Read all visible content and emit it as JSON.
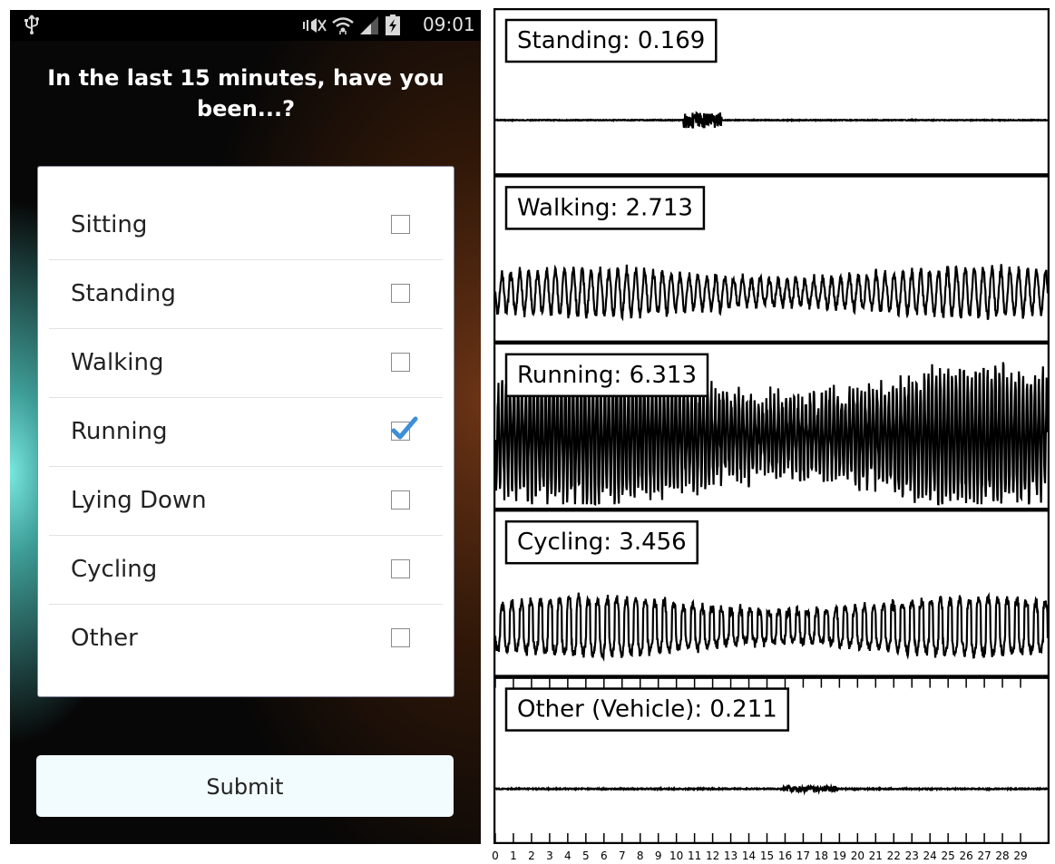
{
  "phone": {
    "status": {
      "time": "09:01",
      "icons": [
        "usb-icon",
        "silent-mode-icon",
        "wifi-icon",
        "signal-icon",
        "battery-charging-icon"
      ]
    },
    "question": "In the last 15 minutes, have you been...?",
    "options": [
      {
        "label": "Sitting",
        "checked": false
      },
      {
        "label": "Standing",
        "checked": false
      },
      {
        "label": "Walking",
        "checked": false
      },
      {
        "label": "Running",
        "checked": true
      },
      {
        "label": "Lying Down",
        "checked": false
      },
      {
        "label": "Cycling",
        "checked": false
      },
      {
        "label": "Other",
        "checked": false
      }
    ],
    "submit_label": "Submit",
    "accent_color": "#3d8fd6"
  },
  "chart_data": {
    "type": "line",
    "x_ticks": [
      "0",
      "1",
      "2",
      "3",
      "4",
      "5",
      "6",
      "7",
      "8",
      "9",
      "10",
      "11",
      "12",
      "13",
      "14",
      "15",
      "16",
      "17",
      "18",
      "19",
      "20",
      "21",
      "22",
      "23",
      "24",
      "25",
      "26",
      "27",
      "28",
      "29"
    ],
    "xlim": [
      0,
      30
    ],
    "grid": false,
    "panels": [
      {
        "label": "Standing: 0.169",
        "value": 0.169
      },
      {
        "label": "Walking: 2.713",
        "value": 2.713
      },
      {
        "label": "Running: 6.313",
        "value": 6.313
      },
      {
        "label": "Cycling: 3.456",
        "value": 3.456
      },
      {
        "label": "Other (Vehicle): 0.211",
        "value": 0.211
      }
    ]
  }
}
